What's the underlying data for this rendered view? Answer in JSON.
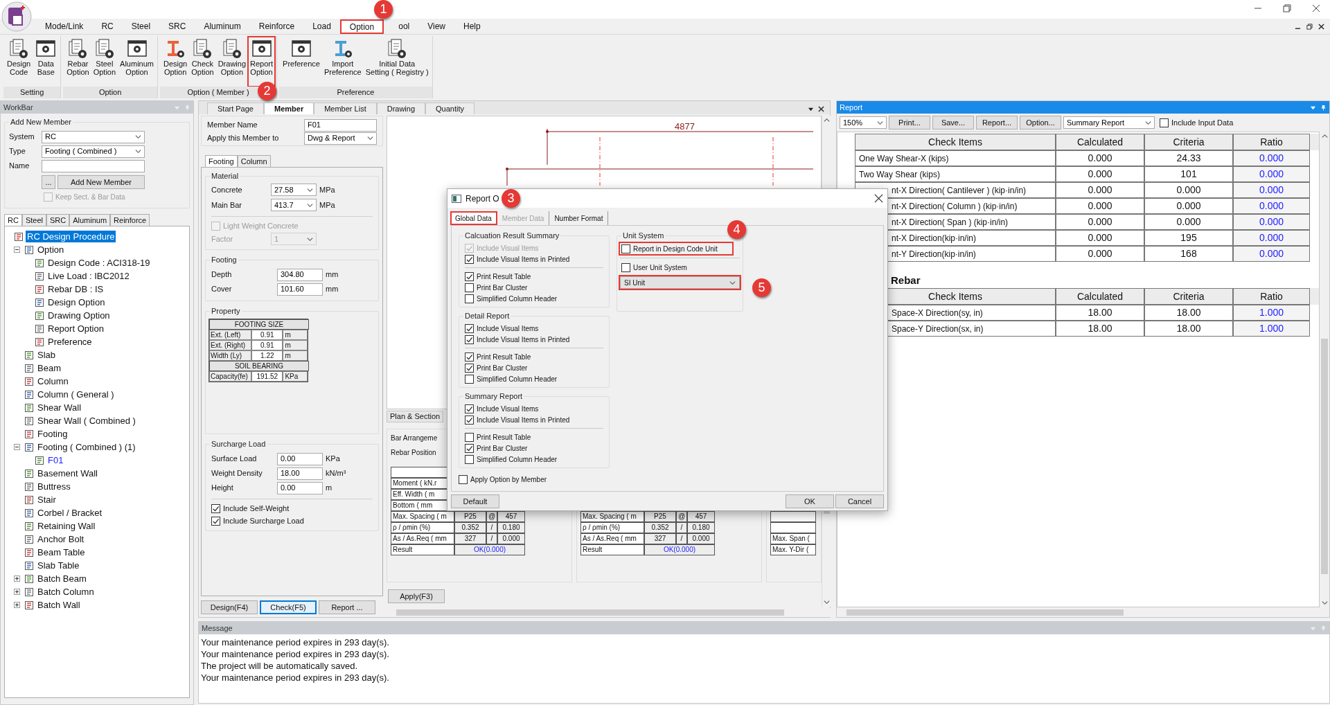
{
  "menu": [
    {
      "label": "Mode/Link",
      "selected": false,
      "highlighted": false
    },
    {
      "label": "RC",
      "selected": false,
      "highlighted": false
    },
    {
      "label": "Steel",
      "selected": false,
      "highlighted": false
    },
    {
      "label": "SRC",
      "selected": false,
      "highlighted": false
    },
    {
      "label": "Aluminum",
      "selected": false,
      "highlighted": false
    },
    {
      "label": "Reinforce",
      "selected": false,
      "highlighted": false
    },
    {
      "label": "Load",
      "selected": false,
      "highlighted": false
    },
    {
      "label": "Option",
      "selected": true,
      "highlighted": true
    },
    {
      "label": "ool",
      "selected": false,
      "highlighted": false
    },
    {
      "label": "View",
      "selected": false,
      "highlighted": false
    },
    {
      "label": "Help",
      "selected": false,
      "highlighted": false
    }
  ],
  "ribbon": [
    {
      "label": "Setting",
      "buttons": [
        {
          "lines": [
            "Design",
            "Code"
          ],
          "highlighted": false
        },
        {
          "lines": [
            "Data",
            "Base"
          ],
          "highlighted": false
        }
      ]
    },
    {
      "label": "Option",
      "buttons": [
        {
          "lines": [
            "Rebar",
            "Option"
          ],
          "highlighted": false
        },
        {
          "lines": [
            "Steel",
            "Option"
          ],
          "highlighted": false
        },
        {
          "lines": [
            "Aluminum",
            "Option"
          ],
          "highlighted": false
        }
      ]
    },
    {
      "label": "Option ( Member )",
      "buttons": [
        {
          "lines": [
            "Design",
            "Option"
          ],
          "highlighted": false
        },
        {
          "lines": [
            "Check",
            "Option"
          ],
          "highlighted": false
        },
        {
          "lines": [
            "Drawing",
            "Option"
          ],
          "highlighted": false
        },
        {
          "lines": [
            "Report",
            "Option"
          ],
          "highlighted": true
        }
      ]
    },
    {
      "label": "Preference",
      "buttons": [
        {
          "lines": [
            "Preference"
          ],
          "highlighted": false
        },
        {
          "lines": [
            "Import",
            "Preference"
          ],
          "highlighted": false
        },
        {
          "lines": [
            "Initial Data",
            "Setting ( Registry )"
          ],
          "highlighted": false
        }
      ]
    }
  ],
  "annotations": [
    {
      "number": "1"
    },
    {
      "number": "2"
    },
    {
      "number": "3"
    },
    {
      "number": "4"
    },
    {
      "number": "5"
    }
  ],
  "workbar": {
    "title": "WorkBar",
    "add_member": {
      "title": "Add New Member",
      "fields": [
        {
          "label": "System",
          "value": "RC",
          "kind": "select"
        },
        {
          "label": "Type",
          "value": "Footing ( Combined )",
          "kind": "select"
        },
        {
          "label": "Name",
          "kind": "text"
        }
      ],
      "browse_button": "...",
      "add_button": "Add New Member",
      "keep": {
        "label": "Keep Sect. & Bar Data",
        "checked": false,
        "disabled": true
      }
    },
    "tabs": [
      {
        "label": "RC",
        "selected": true
      },
      {
        "label": "Steel",
        "selected": false
      },
      {
        "label": "SRC",
        "selected": false
      },
      {
        "label": "Aluminum",
        "selected": false
      },
      {
        "label": "Reinforce",
        "selected": false
      }
    ],
    "tree": [
      {
        "label": "RC Design Procedure",
        "selected": true,
        "children": [
          {
            "label": "Option",
            "selected": false,
            "expanded": true,
            "children": [
              {
                "label": "Design Code : ACI318-19",
                "selected": false
              },
              {
                "label": "Live Load : IBC2012",
                "selected": false
              },
              {
                "label": "Rebar DB : IS",
                "selected": false
              },
              {
                "label": "Design Option",
                "selected": false
              },
              {
                "label": "Drawing Option",
                "selected": false
              },
              {
                "label": "Report Option",
                "selected": false
              },
              {
                "label": "Preference",
                "selected": false
              }
            ]
          },
          {
            "label": "Slab",
            "selected": false
          },
          {
            "label": "Beam",
            "selected": false
          },
          {
            "label": "Column",
            "selected": false
          },
          {
            "label": "Column ( General )",
            "selected": false
          },
          {
            "label": "Shear Wall",
            "selected": false
          },
          {
            "label": "Shear Wall ( Combined )",
            "selected": false
          },
          {
            "label": "Footing",
            "selected": false
          },
          {
            "label": "Footing ( Combined ) (1)",
            "selected": false,
            "expanded": true,
            "children": [
              {
                "label": "F01",
                "selected": false,
                "current": true
              }
            ]
          },
          {
            "label": "Basement Wall",
            "selected": false
          },
          {
            "label": "Buttress",
            "selected": false
          },
          {
            "label": "Stair",
            "selected": false
          },
          {
            "label": "Corbel / Bracket",
            "selected": false
          },
          {
            "label": "Retaining Wall",
            "selected": false
          },
          {
            "label": "Anchor Bolt",
            "selected": false
          },
          {
            "label": "Beam Table",
            "selected": false
          },
          {
            "label": "Slab Table",
            "selected": false
          },
          {
            "label": "Batch Beam",
            "selected": false,
            "expanded": false
          },
          {
            "label": "Batch Column",
            "selected": false,
            "expanded": false
          },
          {
            "label": "Batch Wall",
            "selected": false,
            "expanded": false
          }
        ]
      }
    ]
  },
  "member_panel": {
    "tabs": [
      {
        "label": "Start Page",
        "selected": false
      },
      {
        "label": "Member",
        "selected": true
      },
      {
        "label": "Member List",
        "selected": false
      },
      {
        "label": "Drawing",
        "selected": false
      },
      {
        "label": "Quantity",
        "selected": false
      }
    ],
    "member_name": {
      "label": "Member Name",
      "value": "F01"
    },
    "apply_to": {
      "label": "Apply this Member to",
      "value": "Dwg & Report"
    },
    "sub_tabs": [
      {
        "label": "Footing",
        "selected": true
      },
      {
        "label": "Column",
        "selected": false
      }
    ],
    "material": {
      "title": "Material",
      "rows": [
        {
          "label": "Concrete",
          "value": "27.58",
          "unit": "MPa"
        },
        {
          "label": "Main Bar",
          "value": "413.7",
          "unit": "MPa"
        }
      ],
      "light_weight": {
        "label": "Light Weight Concrete",
        "checked": false,
        "disabled": true
      },
      "factor": {
        "label": "Factor",
        "value": "1",
        "disabled": true
      }
    },
    "footing": {
      "title": "Footing",
      "rows": [
        {
          "label": "Depth",
          "value": "304.80",
          "unit": "mm"
        },
        {
          "label": "Cover",
          "value": "101.60",
          "unit": "mm"
        }
      ]
    },
    "property": {
      "title": "Property",
      "table": [
        {
          "kind": "header",
          "text": "FOOTING SIZE"
        },
        {
          "kind": "row",
          "label": "Ext. (Left)",
          "value": "0.91",
          "unit": "m"
        },
        {
          "kind": "row",
          "label": "Ext. (Right)",
          "value": "0.91",
          "unit": "m"
        },
        {
          "kind": "row",
          "label": "Width (Ly)",
          "value": "1.22",
          "unit": "m"
        },
        {
          "kind": "header",
          "text": "SOIL BEARING"
        },
        {
          "kind": "row",
          "label": "Capacity(fe)",
          "value": "191.52",
          "unit": "KPa"
        }
      ]
    },
    "surcharge": {
      "title": "Surcharge Load",
      "rows": [
        {
          "label": "Surface Load",
          "value": "0.00",
          "unit": "KPa"
        },
        {
          "label": "Weight Density",
          "value": "18.00",
          "unit": "kN/m³"
        },
        {
          "label": "Height",
          "value": "0.00",
          "unit": "m"
        }
      ],
      "checks": [
        {
          "label": "Include Self-Weight",
          "checked": true
        },
        {
          "label": "Include Surcharge Load",
          "checked": true
        }
      ]
    },
    "buttons": [
      {
        "label": "Design(F4)",
        "focused": false
      },
      {
        "label": "Check(F5)",
        "focused": true
      },
      {
        "label": "Report ...",
        "focused": false
      },
      {
        "label": "Apply(F3)",
        "focused": false
      }
    ],
    "dimension": "4877",
    "view_tab": "Plan & Section",
    "bar_groups": [
      {
        "title": "Bar Arrangeme",
        "subtitle": "Rebar Position",
        "rows": [
          {
            "label": "Moment ( kN.r"
          },
          {
            "label": "Eff. Width ( m"
          },
          {
            "label": "Bottom ( mm"
          },
          {
            "label": "Max. Spacing ( m",
            "values": [
              "P25",
              "@",
              "457"
            ]
          },
          {
            "label": "ρ / ρmin (%)",
            "values": [
              "0.352",
              "/",
              "0.180"
            ]
          },
          {
            "label": "As / As.Req ( mm",
            "values": [
              "327",
              "/",
              "0.000"
            ]
          },
          {
            "label": "Result",
            "result": "OK(0.000)"
          }
        ]
      },
      {
        "rows": [
          {
            "label": "Max. Spacing ( m",
            "values": [
              "P25",
              "@",
              "457"
            ]
          },
          {
            "label": "ρ / ρmin (%)",
            "values": [
              "0.352",
              "/",
              "0.180"
            ]
          },
          {
            "label": "As / As.Req ( mm",
            "values": [
              "327",
              "/",
              "0.000"
            ]
          },
          {
            "label": "Result",
            "result": "OK(0.000)"
          }
        ]
      },
      {
        "rows": [
          {
            "label": "Max. Span ("
          },
          {
            "label": "Max. Y-Dir ("
          }
        ]
      }
    ]
  },
  "report": {
    "title": "Report",
    "zoom": "150%",
    "buttons": [
      "Print...",
      "Save...",
      "Report...",
      "Option..."
    ],
    "mode": "Summary Report",
    "include_input": {
      "label": "Include Input Data",
      "checked": false
    },
    "tables": [
      {
        "columns": [
          "Check Items",
          "Calculated",
          "Criteria",
          "Ratio"
        ],
        "rows": [
          {
            "item": "One Way Shear-X (kips)",
            "partly_hidden": false,
            "calculated": "0.000",
            "criteria": "24.33",
            "ratio": "0.000"
          },
          {
            "item": "Two Way Shear (kips)",
            "partly_hidden": false,
            "calculated": "0.000",
            "criteria": "101",
            "ratio": "0.000"
          },
          {
            "item": "nt-X Direction( Cantilever ) (kip·in/in)",
            "partly_hidden": true,
            "calculated": "0.000",
            "criteria": "0.000",
            "ratio": "0.000"
          },
          {
            "item": "nt-X Direction( Column ) (kip·in/in)",
            "partly_hidden": true,
            "calculated": "0.000",
            "criteria": "0.000",
            "ratio": "0.000"
          },
          {
            "item": "nt-X Direction( Span ) (kip·in/in)",
            "partly_hidden": true,
            "calculated": "0.000",
            "criteria": "0.000",
            "ratio": "0.000"
          },
          {
            "item": "nt-X Direction(kip·in/in)",
            "partly_hidden": true,
            "calculated": "0.000",
            "criteria": "195",
            "ratio": "0.000"
          },
          {
            "item": "nt-Y Direction(kip·in/in)",
            "partly_hidden": true,
            "calculated": "0.000",
            "criteria": "168",
            "ratio": "0.000"
          }
        ]
      },
      {
        "heading": "Rebar",
        "columns": [
          "Check Items",
          "Calculated",
          "Criteria",
          "Ratio"
        ],
        "rows": [
          {
            "item": "Space-X Direction(sy, in)",
            "partly_hidden": true,
            "calculated": "18.00",
            "criteria": "18.00",
            "ratio": "1.000"
          },
          {
            "item": "Space-Y Direction(sx, in)",
            "partly_hidden": true,
            "calculated": "18.00",
            "criteria": "18.00",
            "ratio": "1.000"
          }
        ]
      }
    ]
  },
  "message": {
    "title": "Message",
    "lines": [
      "Your maintenance period expires in 293 day(s).",
      "Your maintenance period expires in 293 day(s).",
      "The project will be automatically saved.",
      "Your maintenance period expires in 293 day(s)."
    ]
  },
  "dialog": {
    "title": "Report O",
    "tabs": [
      {
        "label": "Global Data",
        "selected": true,
        "disabled": false,
        "highlighted": true
      },
      {
        "label": "Member Data",
        "selected": false,
        "disabled": true,
        "highlighted": false
      },
      {
        "label": "Number Format",
        "selected": false,
        "disabled": false,
        "highlighted": false
      }
    ],
    "groups": [
      {
        "title": "Calcuation Result Summary",
        "sets": [
          [
            {
              "label": "Include Visual Items",
              "checked": true,
              "disabled": true
            },
            {
              "label": "Include Visual Items in Printed",
              "checked": true,
              "disabled": false
            }
          ],
          [
            {
              "label": "Print Result Table",
              "checked": true,
              "disabled": false
            },
            {
              "label": "Print Bar Cluster",
              "checked": false,
              "disabled": false
            },
            {
              "label": "Simplified Column Header",
              "checked": false,
              "disabled": false
            }
          ]
        ]
      },
      {
        "title": "Detail Report",
        "sets": [
          [
            {
              "label": "Include Visual Items",
              "checked": true,
              "disabled": false
            },
            {
              "label": "Include Visual Items in Printed",
              "checked": true,
              "disabled": false
            }
          ],
          [
            {
              "label": "Print Result Table",
              "checked": true,
              "disabled": false
            },
            {
              "label": "Print Bar Cluster",
              "checked": true,
              "disabled": false
            },
            {
              "label": "Simplified Column Header",
              "checked": false,
              "disabled": false
            }
          ]
        ]
      },
      {
        "title": "Summary Report",
        "sets": [
          [
            {
              "label": "Include Visual Items",
              "checked": true,
              "disabled": false
            },
            {
              "label": "Include Visual Items in Printed",
              "checked": true,
              "disabled": false
            }
          ],
          [
            {
              "label": "Print Result Table",
              "checked": false,
              "disabled": false
            },
            {
              "label": "Print Bar Cluster",
              "checked": true,
              "disabled": false
            },
            {
              "label": "Simplified Column Header",
              "checked": false,
              "disabled": false
            }
          ]
        ]
      }
    ],
    "apply_by_member": {
      "label": "Apply Option by Member",
      "checked": false
    },
    "unit_system": {
      "title": "Unit System",
      "design_code_unit": {
        "label": "Report in Design Code Unit",
        "checked": false,
        "highlighted": true
      },
      "user_unit": {
        "label": "User Unit System",
        "checked": false
      },
      "unit": {
        "value": "SI Unit",
        "highlighted": true
      }
    },
    "buttons": {
      "default": "Default",
      "ok": "OK",
      "cancel": "Cancel"
    }
  }
}
